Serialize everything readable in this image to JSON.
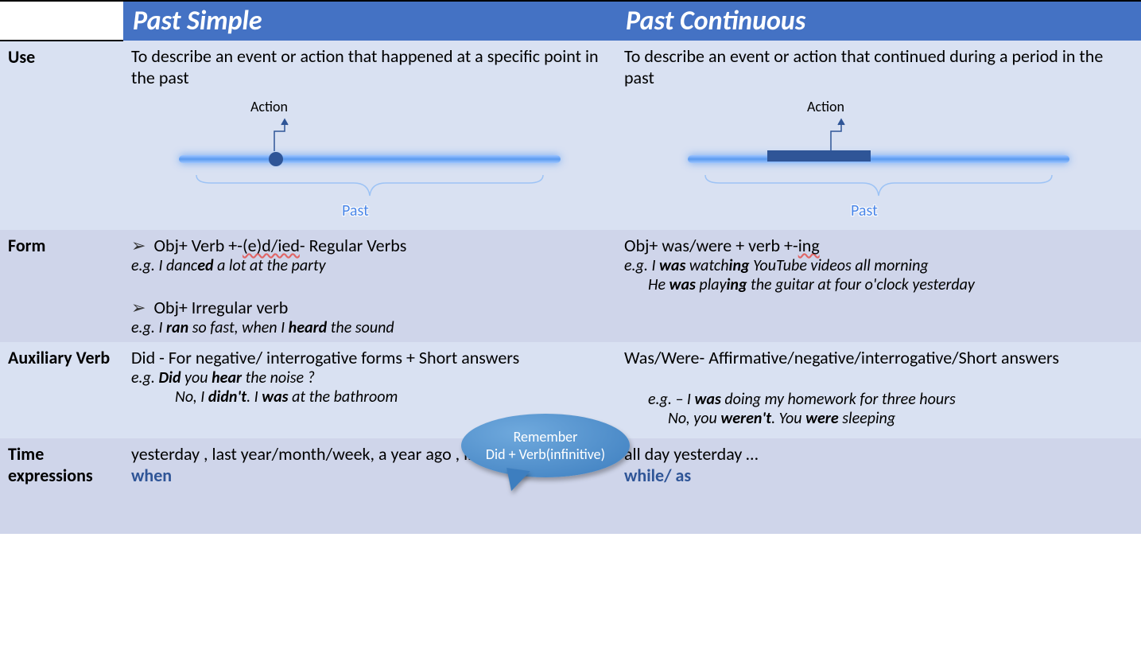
{
  "headers": {
    "col2": "Past Simple",
    "col3": "Past Continuous"
  },
  "rows": {
    "use": {
      "label": "Use",
      "ps": "To describe an event or action that happened at a specific point in the past",
      "pc": "To describe an event or action that continued during a period in the past"
    },
    "diagram": {
      "action": "Action",
      "past": "Past"
    },
    "form": {
      "label": "Form",
      "ps_bullet1_a": "Obj+ Verb +-",
      "ps_bullet1_b": "(e)d/ied",
      "ps_bullet1_c": "- Regular Verbs",
      "ps_eg1_a": "e.g. I danc",
      "ps_eg1_b": "ed",
      "ps_eg1_c": " a lot at the party",
      "ps_bullet2": "Obj+ Irregular verb",
      "ps_eg2_a": "e.g. I ",
      "ps_eg2_b": "ran",
      "ps_eg2_c": " so fast, when I ",
      "ps_eg2_d": "heard",
      "ps_eg2_e": " the sound",
      "pc_line1_a": "Obj+ was/were + verb +-",
      "pc_line1_b": "ing",
      "pc_eg1_a": "e.g. I ",
      "pc_eg1_b": "was",
      "pc_eg1_c": " watch",
      "pc_eg1_d": "ing",
      "pc_eg1_e": " YouTube videos all morning",
      "pc_eg2_a": "He ",
      "pc_eg2_b": "was",
      "pc_eg2_c": " play",
      "pc_eg2_d": "ing",
      "pc_eg2_e": " the guitar at four o'clock yesterday"
    },
    "aux": {
      "label": "Auxiliary Verb",
      "ps_line1": "Did  - For negative/ interrogative forms + Short answers",
      "ps_eg1_a": "e.g. ",
      "ps_eg1_b": "Did",
      "ps_eg1_c": " you ",
      "ps_eg1_d": "hear",
      "ps_eg1_e": " the noise ?",
      "ps_eg2_a": "No, I ",
      "ps_eg2_b": "didn't",
      "ps_eg2_c": ". I ",
      "ps_eg2_d": "was",
      "ps_eg2_e": " at the bathroom",
      "pc_line1": "Was/Were- Affirmative/negative/interrogative/Short answers",
      "pc_eg1_a": "e.g. – I ",
      "pc_eg1_b": "was",
      "pc_eg1_c": " doing my homework for three hours",
      "pc_eg2_a": "No, you ",
      "pc_eg2_b": "weren't",
      "pc_eg2_c": ". You ",
      "pc_eg2_d": "were",
      "pc_eg2_e": " sleeping"
    },
    "time": {
      "label": "Time expressions",
      "ps_line1": "yesterday , last year/month/week, a year ago , in 1989",
      "ps_line2": "when",
      "pc_line1": "all day yesterday …",
      "pc_line2": "while/ as"
    }
  },
  "bubble": {
    "line1": "Remember",
    "line2": "Did + Verb(infinitive)"
  }
}
